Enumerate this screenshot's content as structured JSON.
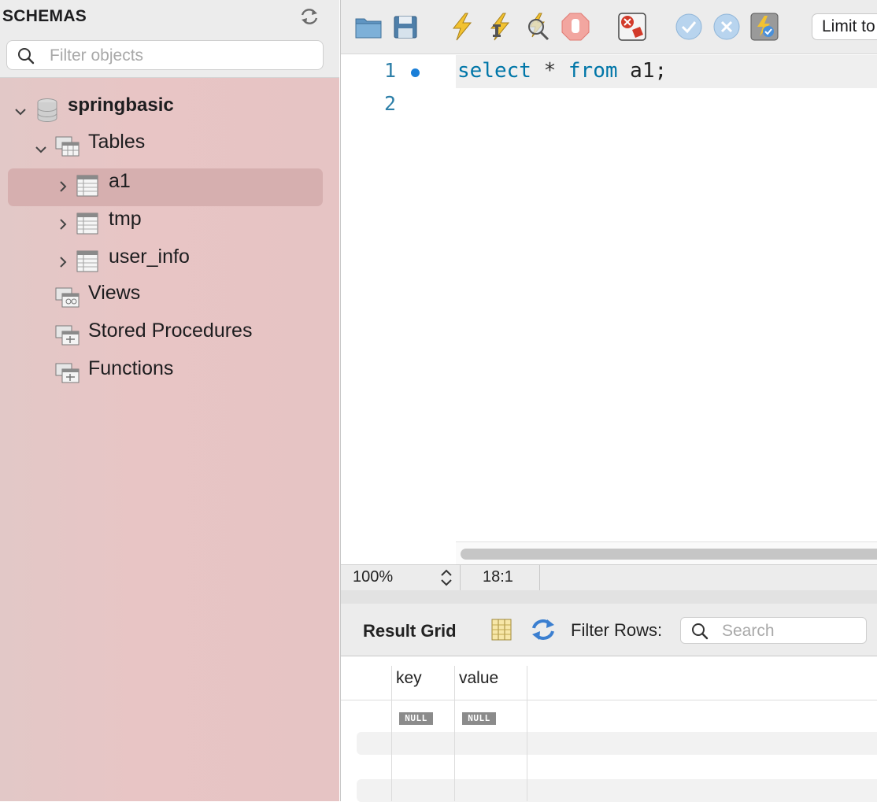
{
  "sidebar": {
    "title": "SCHEMAS",
    "filter_placeholder": "Filter objects",
    "schema": {
      "name": "springbasic",
      "tables_label": "Tables",
      "tables": [
        {
          "name": "a1",
          "selected": true
        },
        {
          "name": "tmp",
          "selected": false
        },
        {
          "name": "user_info",
          "selected": false
        }
      ],
      "views_label": "Views",
      "procedures_label": "Stored Procedures",
      "functions_label": "Functions"
    }
  },
  "toolbar": {
    "icons": [
      "open-file-icon",
      "save-icon",
      "execute-icon",
      "execute-current-icon",
      "explain-icon",
      "stop-icon",
      "toggle-error-stop-icon",
      "commit-icon",
      "rollback-icon",
      "autocommit-icon"
    ],
    "limit_label": "Limit to"
  },
  "editor": {
    "line_numbers": [
      "1",
      "2"
    ],
    "code": {
      "kw1": "select",
      "op": "*",
      "kw2": "from",
      "ident": "a1;"
    }
  },
  "statusbar": {
    "zoom": "100%",
    "position": "18:1"
  },
  "result": {
    "label": "Result Grid",
    "filter_label": "Filter Rows:",
    "search_placeholder": "Search",
    "columns": [
      "key",
      "value"
    ],
    "rows": [
      [
        "NULL",
        "NULL"
      ]
    ]
  }
}
